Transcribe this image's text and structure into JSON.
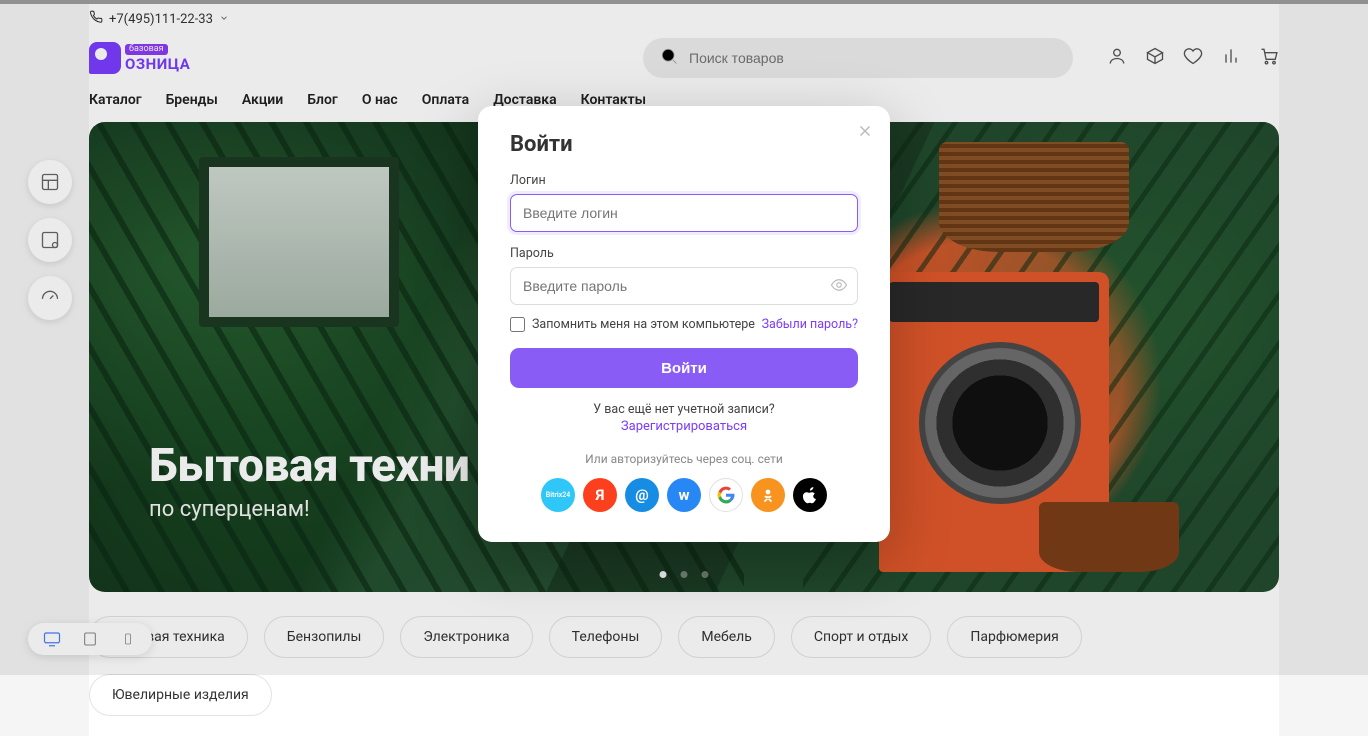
{
  "phone": "+7(495)111-22-33",
  "logo": {
    "badge": "базовая",
    "word": "ОЗНИЦА"
  },
  "search": {
    "placeholder": "Поиск товаров"
  },
  "nav": [
    "Каталог",
    "Бренды",
    "Акции",
    "Блог",
    "О нас",
    "Оплата",
    "Доставка",
    "Контакты"
  ],
  "hero": {
    "title": "Бытовая техни",
    "subtitle": "по суперценам!"
  },
  "categories": [
    "Бытовая техника",
    "Бензопилы",
    "Электроника",
    "Телефоны",
    "Мебель",
    "Спорт и отдых",
    "Парфюмерия",
    "Ювелирные изделия"
  ],
  "modal": {
    "title": "Войти",
    "login_label": "Логин",
    "login_placeholder": "Введите логин",
    "password_label": "Пароль",
    "password_placeholder": "Введите пароль",
    "remember": "Запомнить меня на этом компьютере",
    "forgot": "Забыли пароль?",
    "submit": "Войти",
    "no_account": "У вас ещё нет учетной записи?",
    "register": "Зарегистрироваться",
    "or": "Или авторизуйтесь через соц. сети",
    "socials": {
      "bitrix24": "Bitrix24",
      "yandex": "Я",
      "mailru": "@",
      "vk": "w",
      "google": "G",
      "ok": "✳",
      "apple": ""
    }
  }
}
